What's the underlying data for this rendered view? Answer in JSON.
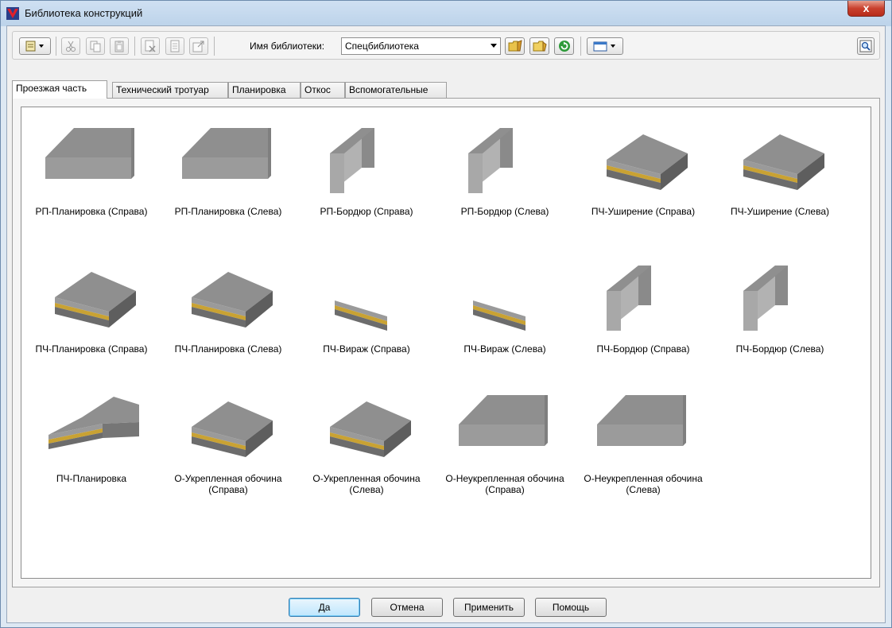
{
  "window": {
    "title": "Библиотека конструкций",
    "close_label": "x"
  },
  "toolbar": {
    "library_label": "Имя библиотеки:",
    "library_value": "Спецбиблиотека"
  },
  "tabs": [
    {
      "label": "Проезжая часть"
    },
    {
      "label": "Технический тротуар"
    },
    {
      "label": "Планировка"
    },
    {
      "label": "Откос"
    },
    {
      "label": "Вспомогательные"
    }
  ],
  "items": [
    {
      "label": "РП-Планировка (Справа)",
      "icon": "slab-plain"
    },
    {
      "label": "РП-Планировка (Слева)",
      "icon": "slab-plain"
    },
    {
      "label": "РП-Бордюр (Справа)",
      "icon": "curb"
    },
    {
      "label": "РП-Бордюр (Слева)",
      "icon": "curb"
    },
    {
      "label": "ПЧ-Уширение (Справа)",
      "icon": "slab-layered"
    },
    {
      "label": "ПЧ-Уширение (Слева)",
      "icon": "slab-layered"
    },
    {
      "label": "ПЧ-Планировка (Справа)",
      "icon": "slab-layered"
    },
    {
      "label": "ПЧ-Планировка (Слева)",
      "icon": "slab-layered"
    },
    {
      "label": "ПЧ-Вираж (Справа)",
      "icon": "curve-layered"
    },
    {
      "label": "ПЧ-Вираж (Слева)",
      "icon": "curve-layered"
    },
    {
      "label": "ПЧ-Бордюр (Справа)",
      "icon": "curb"
    },
    {
      "label": "ПЧ-Бордюр (Слева)",
      "icon": "curb"
    },
    {
      "label": "ПЧ-Планировка",
      "icon": "roof-layered"
    },
    {
      "label": "О-Укрепленная обочина (Справа)",
      "icon": "slab-layered"
    },
    {
      "label": "О-Укрепленная обочина (Слева)",
      "icon": "slab-layered"
    },
    {
      "label": "О-Неукрепленная обочина (Справа)",
      "icon": "slab-plain"
    },
    {
      "label": "О-Неукрепленная обочина (Слева)",
      "icon": "slab-plain"
    }
  ],
  "buttons": {
    "ok": "Да",
    "cancel": "Отмена",
    "apply": "Применить",
    "help": "Помощь"
  },
  "colors": {
    "top": "#8f8f8f",
    "side": "#b2b2b2",
    "front": "#9b9b9b",
    "layer": "#c9a233",
    "base": "#6c6c6c"
  }
}
